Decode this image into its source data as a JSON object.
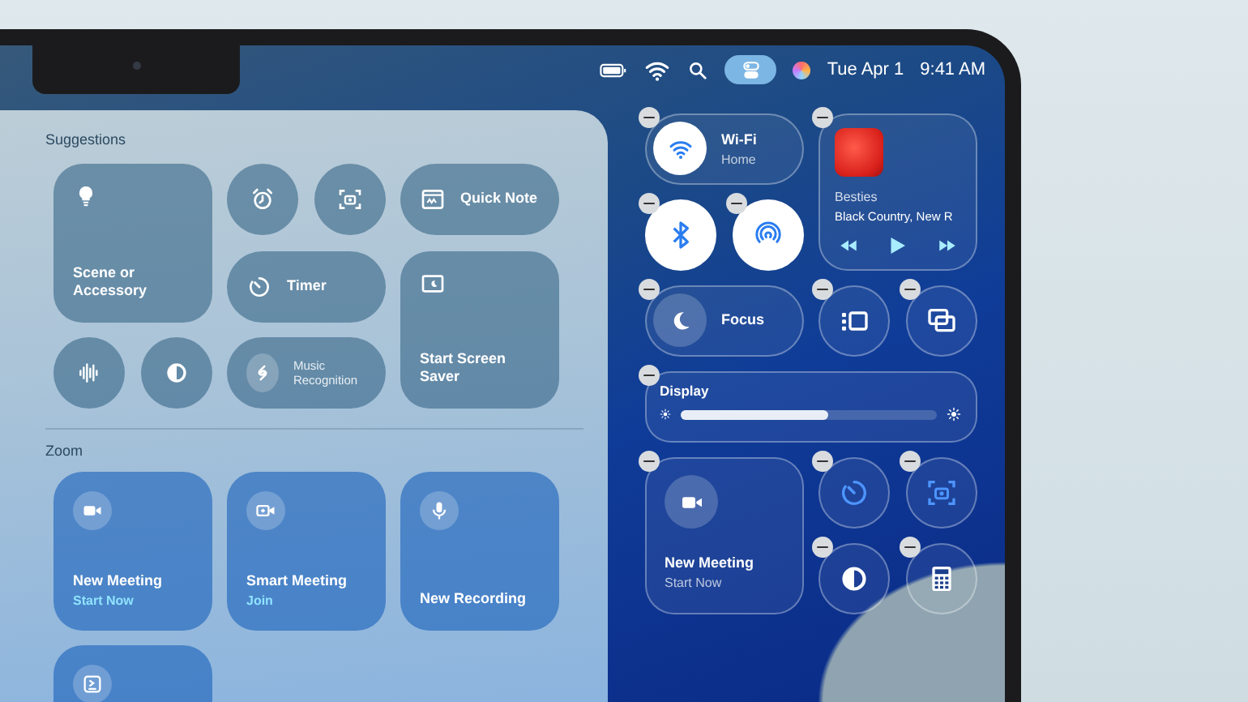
{
  "menu_bar": {
    "control_center_active": true,
    "date": "Tue Apr 1",
    "time": "9:41 AM"
  },
  "gallery": {
    "sections": [
      {
        "title": "Suggestions",
        "tiles": [
          {
            "kind": "large",
            "label": "Scene or Accessory"
          },
          {
            "kind": "circle"
          },
          {
            "kind": "circle"
          },
          {
            "kind": "wide",
            "label": "Quick Note"
          },
          {
            "kind": "wide",
            "label": "Timer"
          },
          {
            "kind": "circle"
          },
          {
            "kind": "circle"
          },
          {
            "kind": "wide",
            "label": "Music Recognition"
          },
          {
            "kind": "large",
            "label": "Start Screen Saver"
          }
        ]
      },
      {
        "title": "Zoom",
        "tiles": [
          {
            "kind": "large",
            "label": "New Meeting",
            "sublabel": "Start Now"
          },
          {
            "kind": "large",
            "label": "Smart Meeting",
            "sublabel": "Join"
          },
          {
            "kind": "large",
            "label": "New Recording"
          },
          {
            "kind": "large"
          }
        ]
      }
    ]
  },
  "control_center": {
    "items": [
      {
        "kind": "wide",
        "label": "Wi-Fi",
        "sublabel": "Home",
        "on": true
      },
      {
        "kind": "music",
        "title": "Besties",
        "artist": "Black Country, New R"
      },
      {
        "kind": "circle",
        "on": true
      },
      {
        "kind": "circle",
        "on": true
      },
      {
        "kind": "wide",
        "label": "Focus",
        "on": false
      },
      {
        "kind": "circle",
        "on": false
      },
      {
        "kind": "circle",
        "on": false
      },
      {
        "kind": "slider",
        "label": "Display",
        "level": 0.58
      },
      {
        "kind": "large",
        "label": "New Meeting",
        "sublabel": "Start Now"
      },
      {
        "kind": "circle",
        "on": false
      },
      {
        "kind": "circle",
        "on": false
      },
      {
        "kind": "circle",
        "on": false
      },
      {
        "kind": "circle",
        "on": false
      }
    ]
  }
}
